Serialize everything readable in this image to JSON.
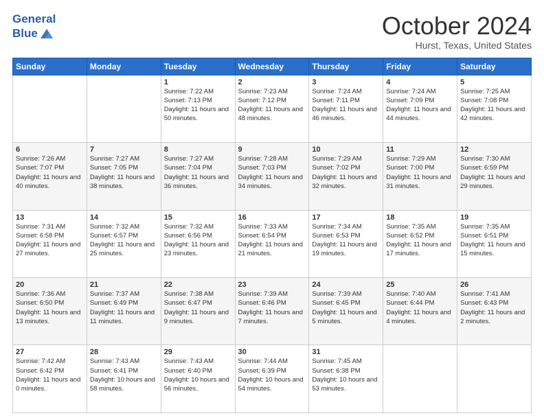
{
  "header": {
    "logo_line1": "General",
    "logo_line2": "Blue",
    "month": "October 2024",
    "location": "Hurst, Texas, United States"
  },
  "days_of_week": [
    "Sunday",
    "Monday",
    "Tuesday",
    "Wednesday",
    "Thursday",
    "Friday",
    "Saturday"
  ],
  "weeks": [
    [
      {
        "num": "",
        "sunrise": "",
        "sunset": "",
        "daylight": ""
      },
      {
        "num": "",
        "sunrise": "",
        "sunset": "",
        "daylight": ""
      },
      {
        "num": "1",
        "sunrise": "Sunrise: 7:22 AM",
        "sunset": "Sunset: 7:13 PM",
        "daylight": "Daylight: 11 hours and 50 minutes."
      },
      {
        "num": "2",
        "sunrise": "Sunrise: 7:23 AM",
        "sunset": "Sunset: 7:12 PM",
        "daylight": "Daylight: 11 hours and 48 minutes."
      },
      {
        "num": "3",
        "sunrise": "Sunrise: 7:24 AM",
        "sunset": "Sunset: 7:11 PM",
        "daylight": "Daylight: 11 hours and 46 minutes."
      },
      {
        "num": "4",
        "sunrise": "Sunrise: 7:24 AM",
        "sunset": "Sunset: 7:09 PM",
        "daylight": "Daylight: 11 hours and 44 minutes."
      },
      {
        "num": "5",
        "sunrise": "Sunrise: 7:25 AM",
        "sunset": "Sunset: 7:08 PM",
        "daylight": "Daylight: 11 hours and 42 minutes."
      }
    ],
    [
      {
        "num": "6",
        "sunrise": "Sunrise: 7:26 AM",
        "sunset": "Sunset: 7:07 PM",
        "daylight": "Daylight: 11 hours and 40 minutes."
      },
      {
        "num": "7",
        "sunrise": "Sunrise: 7:27 AM",
        "sunset": "Sunset: 7:05 PM",
        "daylight": "Daylight: 11 hours and 38 minutes."
      },
      {
        "num": "8",
        "sunrise": "Sunrise: 7:27 AM",
        "sunset": "Sunset: 7:04 PM",
        "daylight": "Daylight: 11 hours and 36 minutes."
      },
      {
        "num": "9",
        "sunrise": "Sunrise: 7:28 AM",
        "sunset": "Sunset: 7:03 PM",
        "daylight": "Daylight: 11 hours and 34 minutes."
      },
      {
        "num": "10",
        "sunrise": "Sunrise: 7:29 AM",
        "sunset": "Sunset: 7:02 PM",
        "daylight": "Daylight: 11 hours and 32 minutes."
      },
      {
        "num": "11",
        "sunrise": "Sunrise: 7:29 AM",
        "sunset": "Sunset: 7:00 PM",
        "daylight": "Daylight: 11 hours and 31 minutes."
      },
      {
        "num": "12",
        "sunrise": "Sunrise: 7:30 AM",
        "sunset": "Sunset: 6:59 PM",
        "daylight": "Daylight: 11 hours and 29 minutes."
      }
    ],
    [
      {
        "num": "13",
        "sunrise": "Sunrise: 7:31 AM",
        "sunset": "Sunset: 6:58 PM",
        "daylight": "Daylight: 11 hours and 27 minutes."
      },
      {
        "num": "14",
        "sunrise": "Sunrise: 7:32 AM",
        "sunset": "Sunset: 6:57 PM",
        "daylight": "Daylight: 11 hours and 25 minutes."
      },
      {
        "num": "15",
        "sunrise": "Sunrise: 7:32 AM",
        "sunset": "Sunset: 6:56 PM",
        "daylight": "Daylight: 11 hours and 23 minutes."
      },
      {
        "num": "16",
        "sunrise": "Sunrise: 7:33 AM",
        "sunset": "Sunset: 6:54 PM",
        "daylight": "Daylight: 11 hours and 21 minutes."
      },
      {
        "num": "17",
        "sunrise": "Sunrise: 7:34 AM",
        "sunset": "Sunset: 6:53 PM",
        "daylight": "Daylight: 11 hours and 19 minutes."
      },
      {
        "num": "18",
        "sunrise": "Sunrise: 7:35 AM",
        "sunset": "Sunset: 6:52 PM",
        "daylight": "Daylight: 11 hours and 17 minutes."
      },
      {
        "num": "19",
        "sunrise": "Sunrise: 7:35 AM",
        "sunset": "Sunset: 6:51 PM",
        "daylight": "Daylight: 11 hours and 15 minutes."
      }
    ],
    [
      {
        "num": "20",
        "sunrise": "Sunrise: 7:36 AM",
        "sunset": "Sunset: 6:50 PM",
        "daylight": "Daylight: 11 hours and 13 minutes."
      },
      {
        "num": "21",
        "sunrise": "Sunrise: 7:37 AM",
        "sunset": "Sunset: 6:49 PM",
        "daylight": "Daylight: 11 hours and 11 minutes."
      },
      {
        "num": "22",
        "sunrise": "Sunrise: 7:38 AM",
        "sunset": "Sunset: 6:47 PM",
        "daylight": "Daylight: 11 hours and 9 minutes."
      },
      {
        "num": "23",
        "sunrise": "Sunrise: 7:39 AM",
        "sunset": "Sunset: 6:46 PM",
        "daylight": "Daylight: 11 hours and 7 minutes."
      },
      {
        "num": "24",
        "sunrise": "Sunrise: 7:39 AM",
        "sunset": "Sunset: 6:45 PM",
        "daylight": "Daylight: 11 hours and 5 minutes."
      },
      {
        "num": "25",
        "sunrise": "Sunrise: 7:40 AM",
        "sunset": "Sunset: 6:44 PM",
        "daylight": "Daylight: 11 hours and 4 minutes."
      },
      {
        "num": "26",
        "sunrise": "Sunrise: 7:41 AM",
        "sunset": "Sunset: 6:43 PM",
        "daylight": "Daylight: 11 hours and 2 minutes."
      }
    ],
    [
      {
        "num": "27",
        "sunrise": "Sunrise: 7:42 AM",
        "sunset": "Sunset: 6:42 PM",
        "daylight": "Daylight: 11 hours and 0 minutes."
      },
      {
        "num": "28",
        "sunrise": "Sunrise: 7:43 AM",
        "sunset": "Sunset: 6:41 PM",
        "daylight": "Daylight: 10 hours and 58 minutes."
      },
      {
        "num": "29",
        "sunrise": "Sunrise: 7:43 AM",
        "sunset": "Sunset: 6:40 PM",
        "daylight": "Daylight: 10 hours and 56 minutes."
      },
      {
        "num": "30",
        "sunrise": "Sunrise: 7:44 AM",
        "sunset": "Sunset: 6:39 PM",
        "daylight": "Daylight: 10 hours and 54 minutes."
      },
      {
        "num": "31",
        "sunrise": "Sunrise: 7:45 AM",
        "sunset": "Sunset: 6:38 PM",
        "daylight": "Daylight: 10 hours and 53 minutes."
      },
      {
        "num": "",
        "sunrise": "",
        "sunset": "",
        "daylight": ""
      },
      {
        "num": "",
        "sunrise": "",
        "sunset": "",
        "daylight": ""
      }
    ]
  ]
}
